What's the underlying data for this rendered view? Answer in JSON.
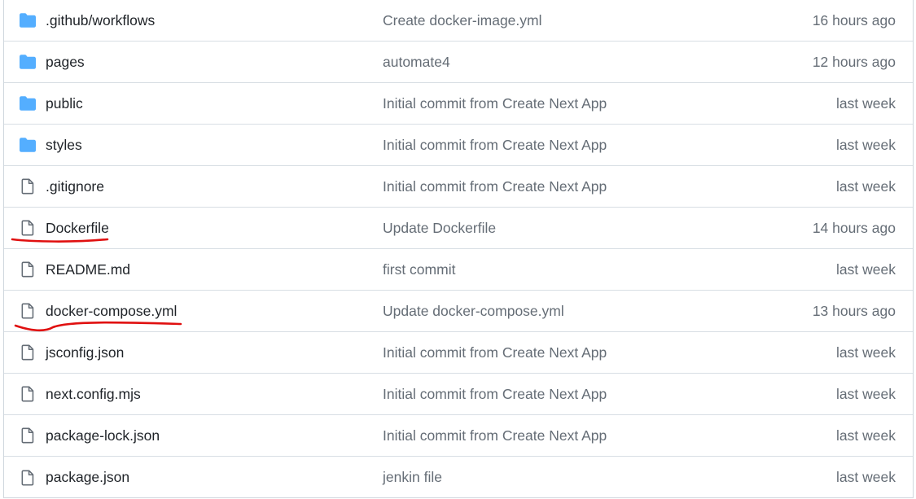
{
  "colors": {
    "folder": "#54aeff",
    "file_icon": "#656d76",
    "name_text": "#1f2328",
    "muted_text": "#656d76",
    "border": "#d8dee4",
    "annotation": "#e01010"
  },
  "rows": [
    {
      "type": "folder",
      "icon": "folder-icon",
      "name": ".github/workflows",
      "message": "Create docker-image.yml",
      "age": "16 hours ago",
      "underlined": false
    },
    {
      "type": "folder",
      "icon": "folder-icon",
      "name": "pages",
      "message": "automate4",
      "age": "12 hours ago",
      "underlined": false
    },
    {
      "type": "folder",
      "icon": "folder-icon",
      "name": "public",
      "message": "Initial commit from Create Next App",
      "age": "last week",
      "underlined": false
    },
    {
      "type": "folder",
      "icon": "folder-icon",
      "name": "styles",
      "message": "Initial commit from Create Next App",
      "age": "last week",
      "underlined": false
    },
    {
      "type": "file",
      "icon": "file-icon",
      "name": ".gitignore",
      "message": "Initial commit from Create Next App",
      "age": "last week",
      "underlined": false
    },
    {
      "type": "file",
      "icon": "file-icon",
      "name": "Dockerfile",
      "message": "Update Dockerfile",
      "age": "14 hours ago",
      "underlined": true
    },
    {
      "type": "file",
      "icon": "file-icon",
      "name": "README.md",
      "message": "first commit",
      "age": "last week",
      "underlined": false
    },
    {
      "type": "file",
      "icon": "file-icon",
      "name": "docker-compose.yml",
      "message": "Update docker-compose.yml",
      "age": "13 hours ago",
      "underlined": true
    },
    {
      "type": "file",
      "icon": "file-icon",
      "name": "jsconfig.json",
      "message": "Initial commit from Create Next App",
      "age": "last week",
      "underlined": false
    },
    {
      "type": "file",
      "icon": "file-icon",
      "name": "next.config.mjs",
      "message": "Initial commit from Create Next App",
      "age": "last week",
      "underlined": false
    },
    {
      "type": "file",
      "icon": "file-icon",
      "name": "package-lock.json",
      "message": "Initial commit from Create Next App",
      "age": "last week",
      "underlined": false
    },
    {
      "type": "file",
      "icon": "file-icon",
      "name": "package.json",
      "message": "jenkin file",
      "age": "last week",
      "underlined": false
    }
  ]
}
